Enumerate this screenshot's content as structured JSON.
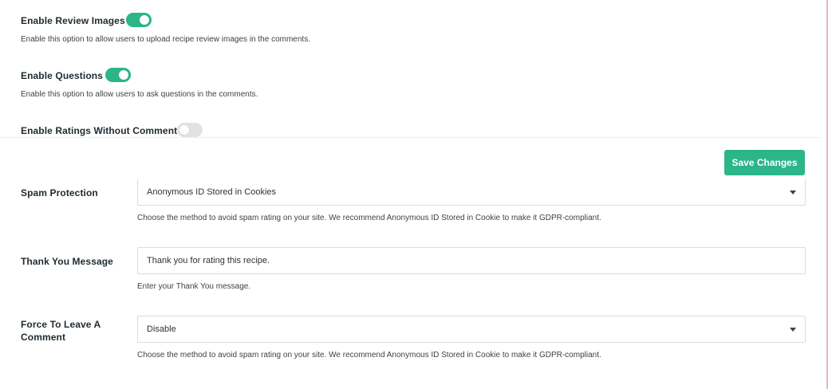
{
  "toggles": {
    "review_images": {
      "label": "Enable Review Images",
      "description": "Enable this option to allow users to upload recipe review images in the comments.",
      "enabled": true
    },
    "questions": {
      "label": "Enable Questions",
      "description": "Enable this option to allow users to ask questions in the comments.",
      "enabled": true
    },
    "ratings_without_comment": {
      "label": "Enable Ratings Without Comment",
      "enabled": false
    }
  },
  "save_button": {
    "label": "Save Changes"
  },
  "spam_protection": {
    "label": "Spam Protection",
    "selected": "Anonymous ID Stored in Cookies",
    "description": "Choose the method to avoid spam rating on your site. We recommend Anonymous ID Stored in Cookie to make it GDPR-compliant."
  },
  "thank_you": {
    "label": "Thank You Message",
    "value": "Thank you for rating this recipe.",
    "description": "Enter your Thank You message."
  },
  "force_comment": {
    "label_line1": "Force To Leave A",
    "label_line2": "Comment",
    "selected": "Disable",
    "description": "Choose the method to avoid spam rating on your site. We recommend Anonymous ID Stored in Cookie to make it GDPR-compliant."
  },
  "colors": {
    "accent": "#2bb589",
    "toggle_off": "#e2e2e2"
  }
}
